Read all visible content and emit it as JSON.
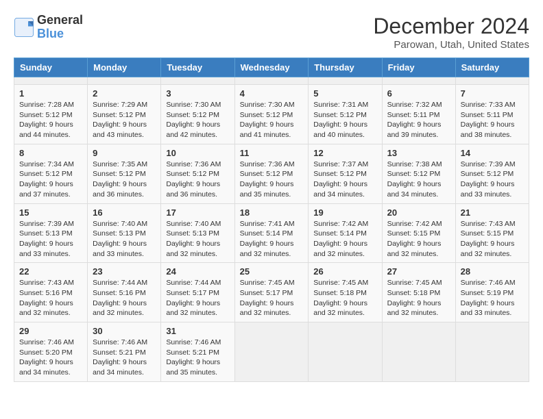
{
  "header": {
    "logo_line1": "General",
    "logo_line2": "Blue",
    "title": "December 2024",
    "subtitle": "Parowan, Utah, United States"
  },
  "calendar": {
    "headers": [
      "Sunday",
      "Monday",
      "Tuesday",
      "Wednesday",
      "Thursday",
      "Friday",
      "Saturday"
    ],
    "weeks": [
      [
        {
          "day": "",
          "empty": true
        },
        {
          "day": "",
          "empty": true
        },
        {
          "day": "",
          "empty": true
        },
        {
          "day": "",
          "empty": true
        },
        {
          "day": "",
          "empty": true
        },
        {
          "day": "",
          "empty": true
        },
        {
          "day": "",
          "empty": true
        }
      ],
      [
        {
          "day": "1",
          "sunrise": "7:28 AM",
          "sunset": "5:12 PM",
          "daylight": "9 hours and 44 minutes."
        },
        {
          "day": "2",
          "sunrise": "7:29 AM",
          "sunset": "5:12 PM",
          "daylight": "9 hours and 43 minutes."
        },
        {
          "day": "3",
          "sunrise": "7:30 AM",
          "sunset": "5:12 PM",
          "daylight": "9 hours and 42 minutes."
        },
        {
          "day": "4",
          "sunrise": "7:30 AM",
          "sunset": "5:12 PM",
          "daylight": "9 hours and 41 minutes."
        },
        {
          "day": "5",
          "sunrise": "7:31 AM",
          "sunset": "5:12 PM",
          "daylight": "9 hours and 40 minutes."
        },
        {
          "day": "6",
          "sunrise": "7:32 AM",
          "sunset": "5:11 PM",
          "daylight": "9 hours and 39 minutes."
        },
        {
          "day": "7",
          "sunrise": "7:33 AM",
          "sunset": "5:11 PM",
          "daylight": "9 hours and 38 minutes."
        }
      ],
      [
        {
          "day": "8",
          "sunrise": "7:34 AM",
          "sunset": "5:12 PM",
          "daylight": "9 hours and 37 minutes."
        },
        {
          "day": "9",
          "sunrise": "7:35 AM",
          "sunset": "5:12 PM",
          "daylight": "9 hours and 36 minutes."
        },
        {
          "day": "10",
          "sunrise": "7:36 AM",
          "sunset": "5:12 PM",
          "daylight": "9 hours and 36 minutes."
        },
        {
          "day": "11",
          "sunrise": "7:36 AM",
          "sunset": "5:12 PM",
          "daylight": "9 hours and 35 minutes."
        },
        {
          "day": "12",
          "sunrise": "7:37 AM",
          "sunset": "5:12 PM",
          "daylight": "9 hours and 34 minutes."
        },
        {
          "day": "13",
          "sunrise": "7:38 AM",
          "sunset": "5:12 PM",
          "daylight": "9 hours and 34 minutes."
        },
        {
          "day": "14",
          "sunrise": "7:39 AM",
          "sunset": "5:12 PM",
          "daylight": "9 hours and 33 minutes."
        }
      ],
      [
        {
          "day": "15",
          "sunrise": "7:39 AM",
          "sunset": "5:13 PM",
          "daylight": "9 hours and 33 minutes."
        },
        {
          "day": "16",
          "sunrise": "7:40 AM",
          "sunset": "5:13 PM",
          "daylight": "9 hours and 33 minutes."
        },
        {
          "day": "17",
          "sunrise": "7:40 AM",
          "sunset": "5:13 PM",
          "daylight": "9 hours and 32 minutes."
        },
        {
          "day": "18",
          "sunrise": "7:41 AM",
          "sunset": "5:14 PM",
          "daylight": "9 hours and 32 minutes."
        },
        {
          "day": "19",
          "sunrise": "7:42 AM",
          "sunset": "5:14 PM",
          "daylight": "9 hours and 32 minutes."
        },
        {
          "day": "20",
          "sunrise": "7:42 AM",
          "sunset": "5:15 PM",
          "daylight": "9 hours and 32 minutes."
        },
        {
          "day": "21",
          "sunrise": "7:43 AM",
          "sunset": "5:15 PM",
          "daylight": "9 hours and 32 minutes."
        }
      ],
      [
        {
          "day": "22",
          "sunrise": "7:43 AM",
          "sunset": "5:16 PM",
          "daylight": "9 hours and 32 minutes."
        },
        {
          "day": "23",
          "sunrise": "7:44 AM",
          "sunset": "5:16 PM",
          "daylight": "9 hours and 32 minutes."
        },
        {
          "day": "24",
          "sunrise": "7:44 AM",
          "sunset": "5:17 PM",
          "daylight": "9 hours and 32 minutes."
        },
        {
          "day": "25",
          "sunrise": "7:45 AM",
          "sunset": "5:17 PM",
          "daylight": "9 hours and 32 minutes."
        },
        {
          "day": "26",
          "sunrise": "7:45 AM",
          "sunset": "5:18 PM",
          "daylight": "9 hours and 32 minutes."
        },
        {
          "day": "27",
          "sunrise": "7:45 AM",
          "sunset": "5:18 PM",
          "daylight": "9 hours and 32 minutes."
        },
        {
          "day": "28",
          "sunrise": "7:46 AM",
          "sunset": "5:19 PM",
          "daylight": "9 hours and 33 minutes."
        }
      ],
      [
        {
          "day": "29",
          "sunrise": "7:46 AM",
          "sunset": "5:20 PM",
          "daylight": "9 hours and 34 minutes."
        },
        {
          "day": "30",
          "sunrise": "7:46 AM",
          "sunset": "5:21 PM",
          "daylight": "9 hours and 34 minutes."
        },
        {
          "day": "31",
          "sunrise": "7:46 AM",
          "sunset": "5:21 PM",
          "daylight": "9 hours and 35 minutes."
        },
        {
          "day": "",
          "empty": true
        },
        {
          "day": "",
          "empty": true
        },
        {
          "day": "",
          "empty": true
        },
        {
          "day": "",
          "empty": true
        }
      ]
    ]
  }
}
